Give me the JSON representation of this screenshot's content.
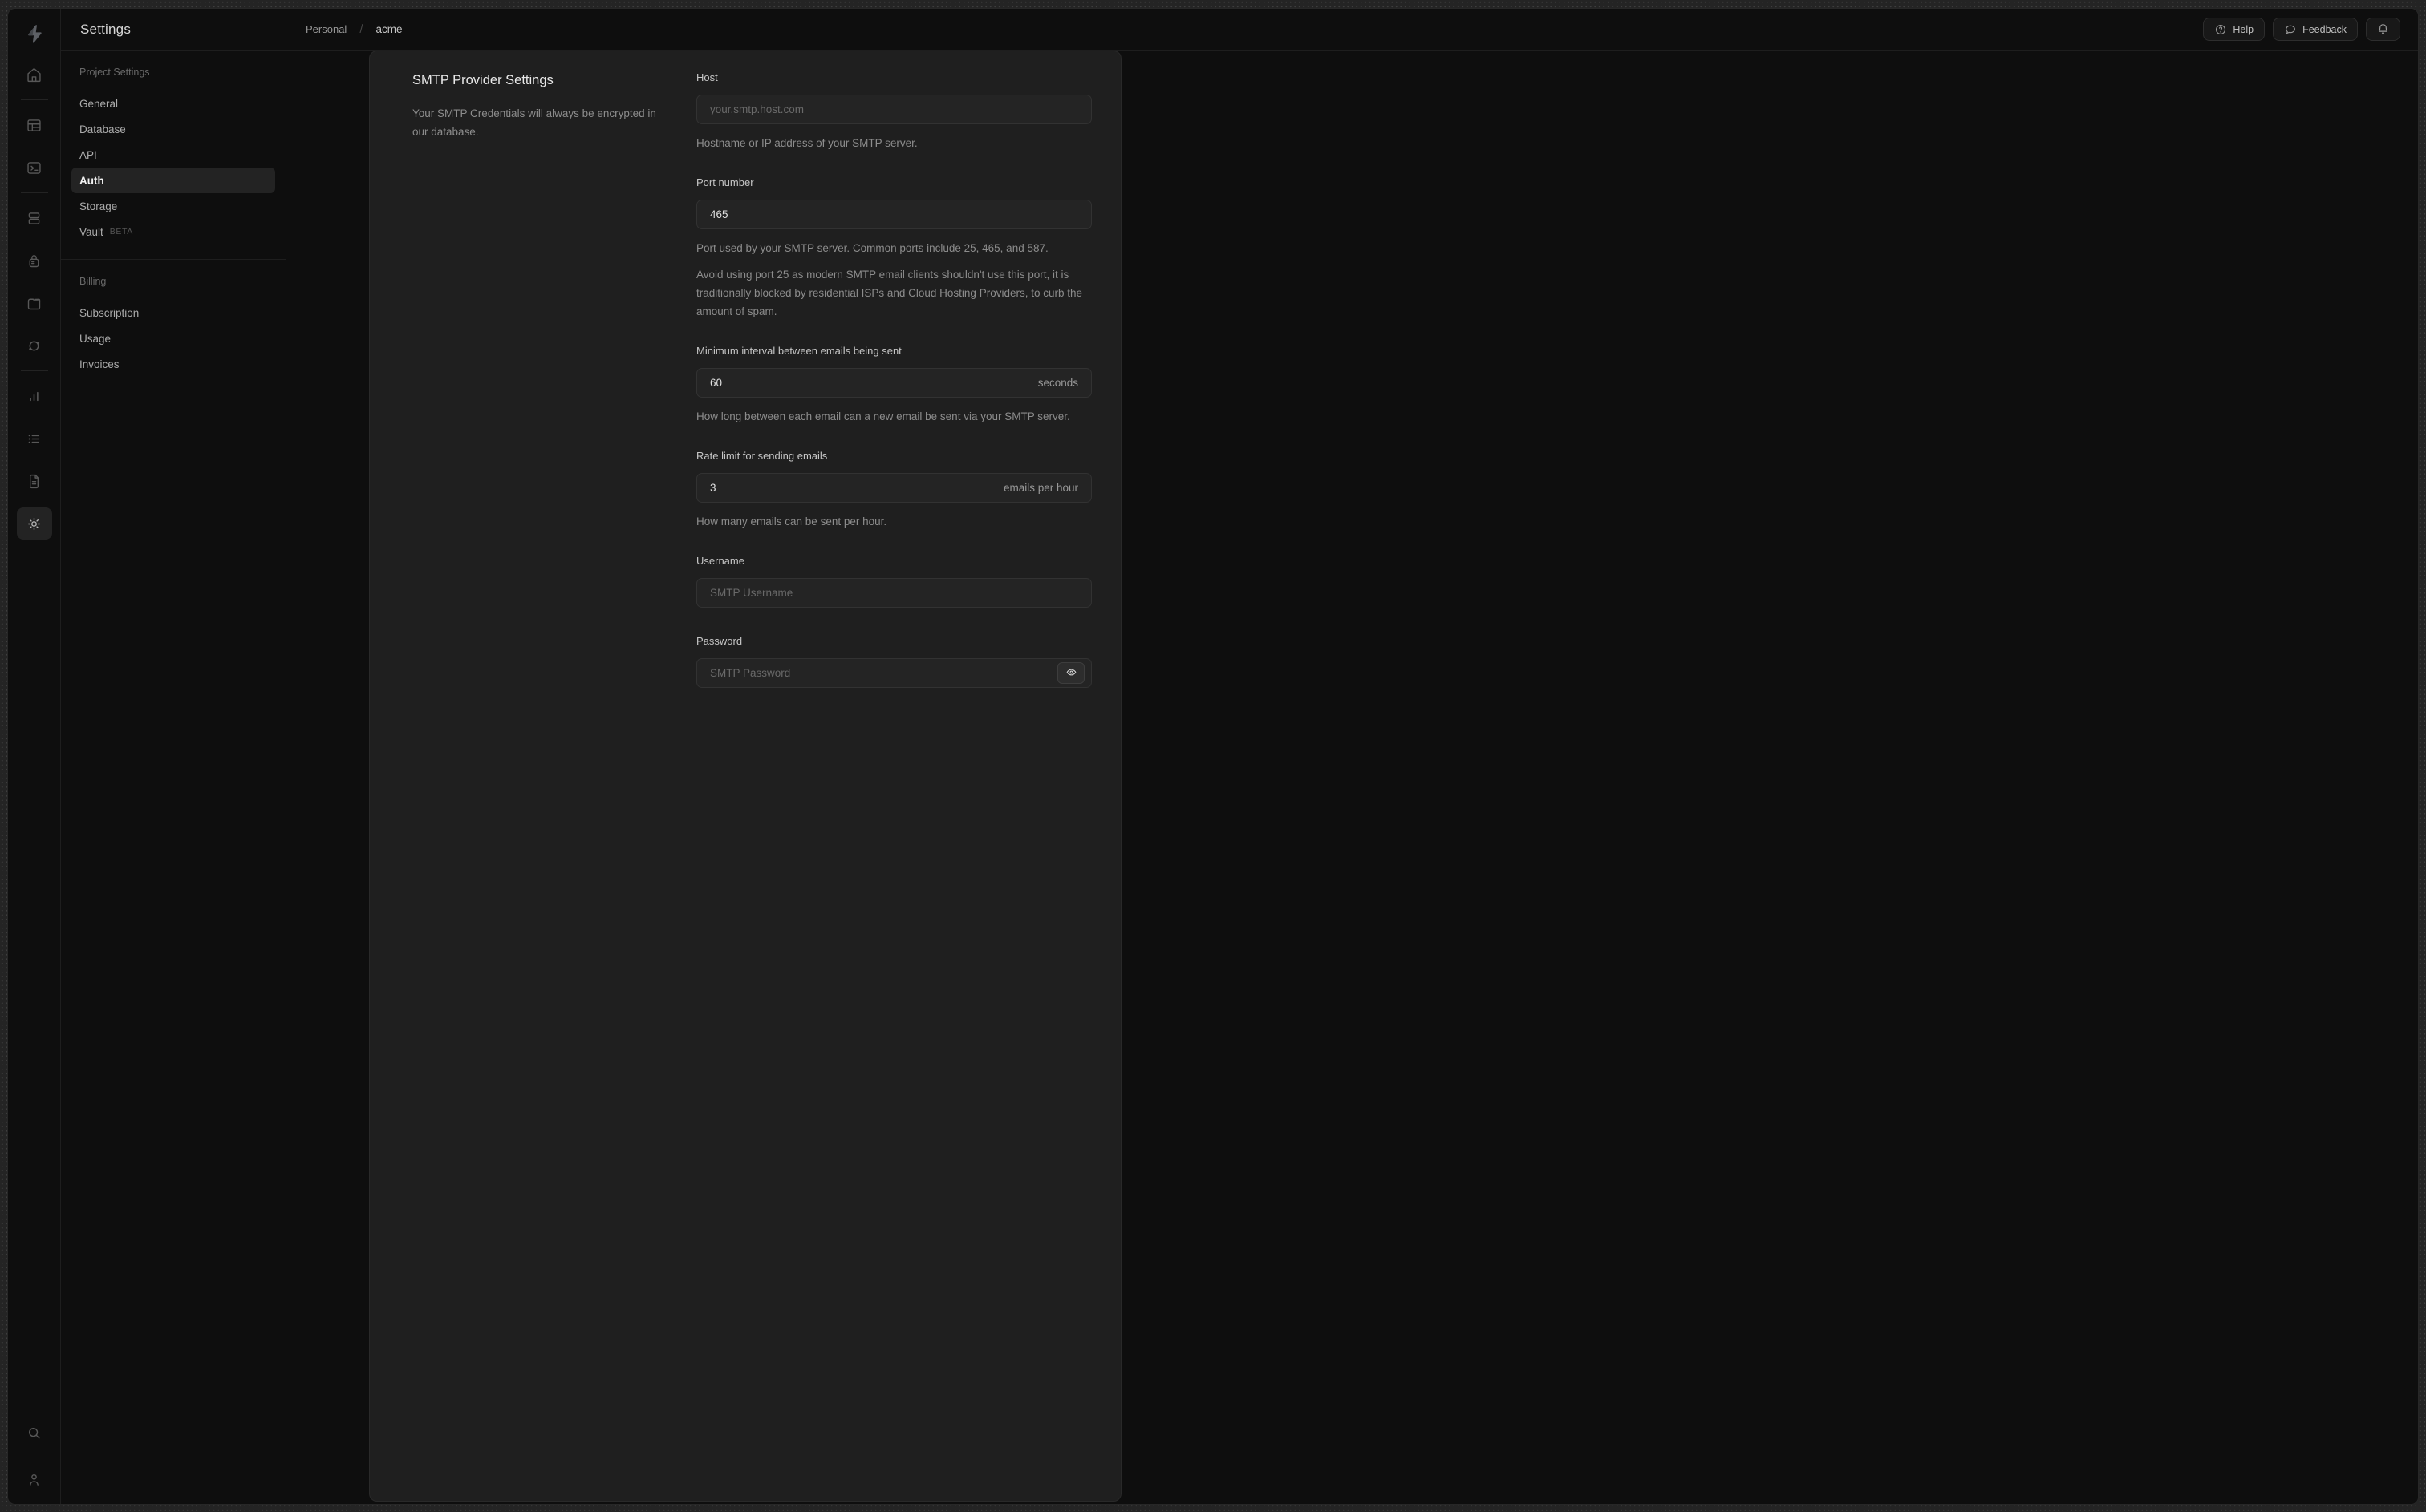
{
  "app": {
    "title": "Settings"
  },
  "breadcrumb": {
    "org": "Personal",
    "separator": "/",
    "project": "acme"
  },
  "topbar": {
    "help_label": "Help",
    "feedback_label": "Feedback",
    "icons": [
      "question-circle-icon",
      "speech-bubble-icon",
      "bell-icon"
    ]
  },
  "rail": {
    "icons": [
      "supabase-logo",
      "home-icon",
      "table-editor-icon",
      "sql-editor-icon",
      "database-icon",
      "authentication-icon",
      "storage-icon",
      "edge-functions-icon",
      "reports-icon",
      "logs-icon",
      "api-docs-icon",
      "project-settings-icon",
      "search-icon",
      "account-icon"
    ],
    "active_icon": "project-settings-icon"
  },
  "menu": {
    "sections": [
      {
        "label": "Project Settings",
        "items": [
          {
            "label": "General"
          },
          {
            "label": "Database"
          },
          {
            "label": "API"
          },
          {
            "label": "Auth",
            "active": true
          },
          {
            "label": "Storage"
          },
          {
            "label": "Vault",
            "badge": "BETA"
          }
        ]
      },
      {
        "label": "Billing",
        "items": [
          {
            "label": "Subscription"
          },
          {
            "label": "Usage"
          },
          {
            "label": "Invoices"
          }
        ]
      }
    ]
  },
  "smtp": {
    "heading": "SMTP Provider Settings",
    "description": "Your SMTP Credentials will always be encrypted in our database.",
    "host": {
      "label": "Host",
      "placeholder": "your.smtp.host.com",
      "helper": "Hostname or IP address of your SMTP server."
    },
    "port": {
      "label": "Port number",
      "value": "465",
      "helper": "Port used by your SMTP server. Common ports include 25, 465, and 587.",
      "note": "Avoid using port 25 as modern SMTP email clients shouldn't use this port, it is traditionally blocked by residential ISPs and Cloud Hosting Providers, to curb the amount of spam."
    },
    "interval": {
      "label": "Minimum interval between emails being sent",
      "value": "60",
      "suffix": "seconds",
      "helper": "How long between each email can a new email be sent via your SMTP server."
    },
    "rate": {
      "label": "Rate limit for sending emails",
      "value": "3",
      "suffix": "emails per hour",
      "helper": "How many emails can be sent per hour."
    },
    "username": {
      "label": "Username",
      "placeholder": "SMTP Username"
    },
    "password": {
      "label": "Password",
      "placeholder": "SMTP Password"
    }
  },
  "colors": {
    "page_dots_bg": "#242424",
    "window_bg": "#0e0e0e",
    "card_bg": "#1f1f1f",
    "active_item_bg": "#232323",
    "input_bg": "#242424"
  }
}
